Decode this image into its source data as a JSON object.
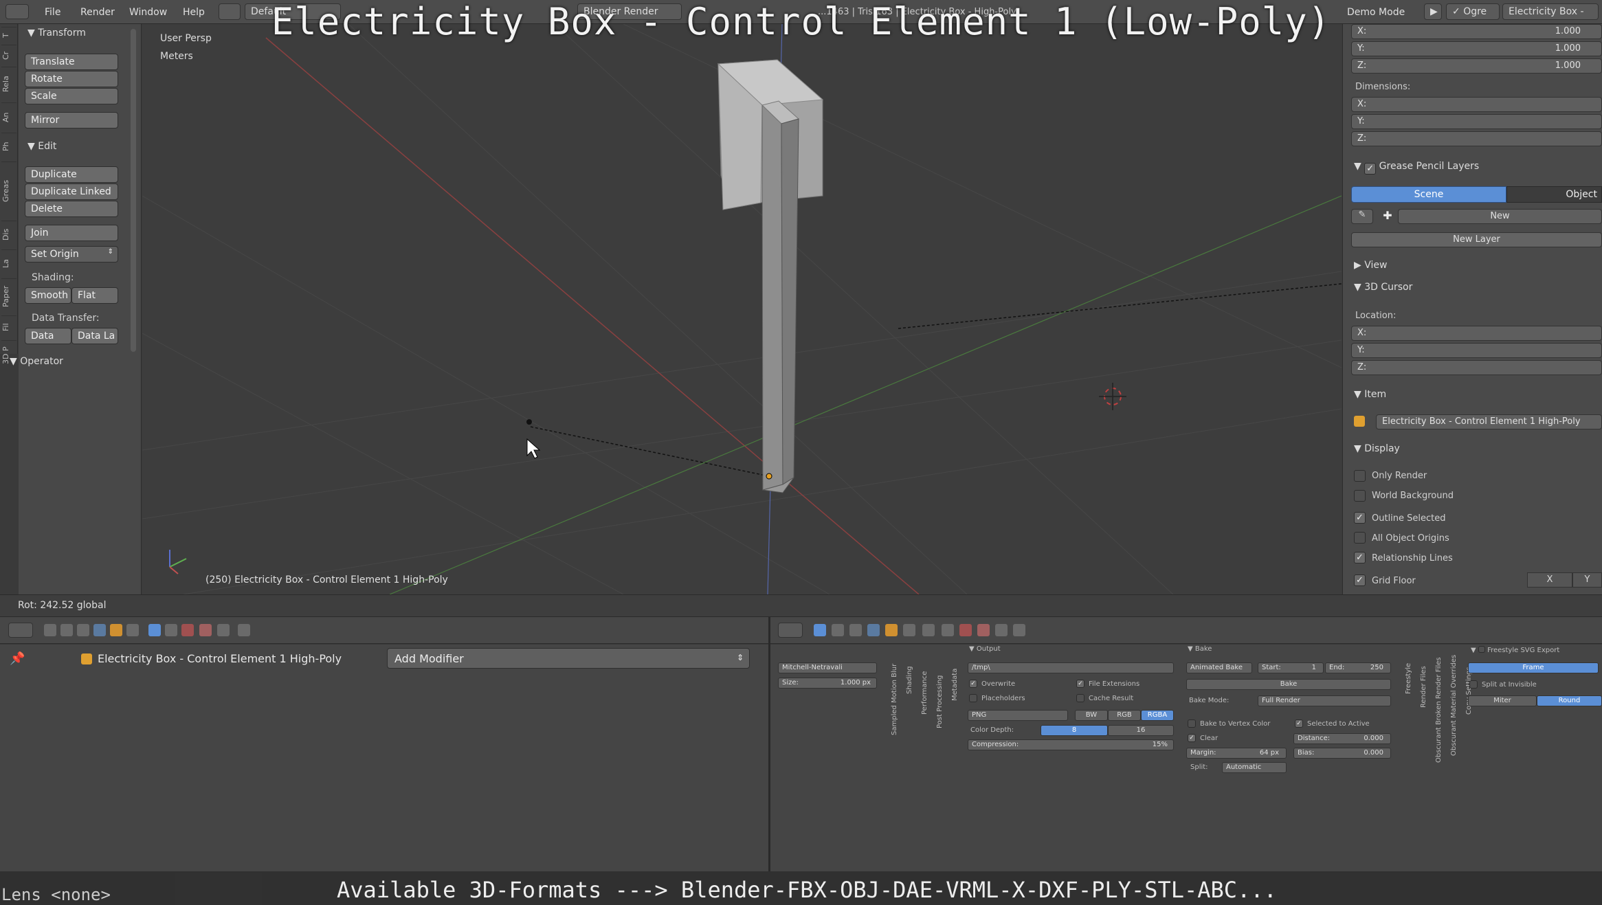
{
  "overlay": {
    "title": "Electricity Box - Control Element 1 (Low-Poly)",
    "footer_caption": "Available 3D-Formats ---> Blender-FBX-OBJ-DAE-VRML-X-DXF-PLY-STL-ABC...",
    "footer_lens": "Lens <none>"
  },
  "topbar": {
    "menus": [
      "File",
      "Render",
      "Window",
      "Help"
    ],
    "layout": "Default",
    "engine": "Blender Render",
    "stats": "...1463 | Tris:163 | Electricity Box - High-Poly",
    "demo_mode": "Demo Mode",
    "ogre": "Ogre",
    "scene_name": "Electricity Box -"
  },
  "toolshelf": {
    "tabs": [
      "T",
      "Cr",
      "Rela",
      "An",
      "Ph",
      "Greas",
      "Dis",
      "La",
      "Paper",
      "Fil",
      "3D P"
    ],
    "transform_header": "Transform",
    "translate": "Translate",
    "rotate": "Rotate",
    "scale": "Scale",
    "mirror": "Mirror",
    "edit_header": "Edit",
    "duplicate": "Duplicate",
    "duplicate_linked": "Duplicate Linked",
    "delete": "Delete",
    "join": "Join",
    "set_origin": "Set Origin",
    "shading_label": "Shading:",
    "smooth": "Smooth",
    "flat": "Flat",
    "data_transfer_label": "Data Transfer:",
    "data": "Data",
    "data_la": "Data La",
    "operator_header": "Operator"
  },
  "viewport": {
    "view_name": "User Persp",
    "units": "Meters",
    "object_info": "(250) Electricity Box - Control Element 1 High-Poly"
  },
  "status": {
    "rotation": "Rot: 242.52 global"
  },
  "rightpanel": {
    "scale_x": "1.000",
    "scale_y": "1.000",
    "scale_z": "1.000",
    "axis_x": "X:",
    "axis_y": "Y:",
    "axis_z": "Z:",
    "dimensions_label": "Dimensions:",
    "grease_header": "Grease Pencil Layers",
    "scene_tab": "Scene",
    "object_tab": "Object",
    "new_btn": "New",
    "new_layer_btn": "New Layer",
    "view_header": "View",
    "cursor_header": "3D Cursor",
    "location_label": "Location:",
    "item_header": "Item",
    "item_name": "Electricity Box - Control Element 1 High-Poly",
    "display_header": "Display",
    "only_render": "Only Render",
    "world_background": "World Background",
    "outline_selected": "Outline Selected",
    "all_object_origins": "All Object Origins",
    "relationship_lines": "Relationship Lines",
    "grid_floor": "Grid Floor",
    "grid_x": "X",
    "grid_y": "Y",
    "accent": "#5b8fd6"
  },
  "modifiers": {
    "object_name": "Electricity Box - Control Element 1 High-Poly",
    "add_modifier": "Add Modifier"
  },
  "render_props": {
    "filter": "Mitchell-Netravali",
    "size_label": "Size:",
    "size_value": "1.000 px",
    "vertical_tabs": [
      "Sampled Motion Blur",
      "Shading",
      "Performance",
      "Post Processing",
      "Metadata"
    ],
    "output_header": "Output",
    "output_path": "/tmp\\",
    "overwrite": "Overwrite",
    "file_extensions": "File Extensions",
    "placeholders": "Placeholders",
    "cache_result": "Cache Result",
    "format": "PNG",
    "bw": "BW",
    "rgb": "RGB",
    "rgba": "RGBA",
    "color_depth_label": "Color Depth:",
    "depth_8": "8",
    "depth_16": "16",
    "compression_label": "Compression:",
    "compression_value": "15%",
    "bake_header": "Bake",
    "animated_bake": "Animated Bake",
    "start_label": "Start:",
    "start_value": "1",
    "end_label": "End:",
    "end_value": "250",
    "bake_btn": "Bake",
    "bake_mode_label": "Bake Mode:",
    "bake_mode_value": "Full Render",
    "bake_to_vertex": "Bake to Vertex Color",
    "selected_to_active": "Selected to Active",
    "clear": "Clear",
    "distance_label": "Distance:",
    "distance_value": "0.000",
    "margin_label": "Margin:",
    "margin_value": "64 px",
    "bias_label": "Bias:",
    "bias_value": "0.000",
    "split_label": "Split:",
    "split_value": "Automatic",
    "vertical_tabs2": [
      "Freestyle",
      "Render Files",
      "Obscurant Broken Render Files",
      "Obscurant Material Overrides",
      "Copy Settings"
    ],
    "freestyle_header": "Freestyle SVG Export",
    "frame_btn": "Frame",
    "split_invisible": "Split at Invisible",
    "miter": "Miter",
    "round": "Round"
  }
}
